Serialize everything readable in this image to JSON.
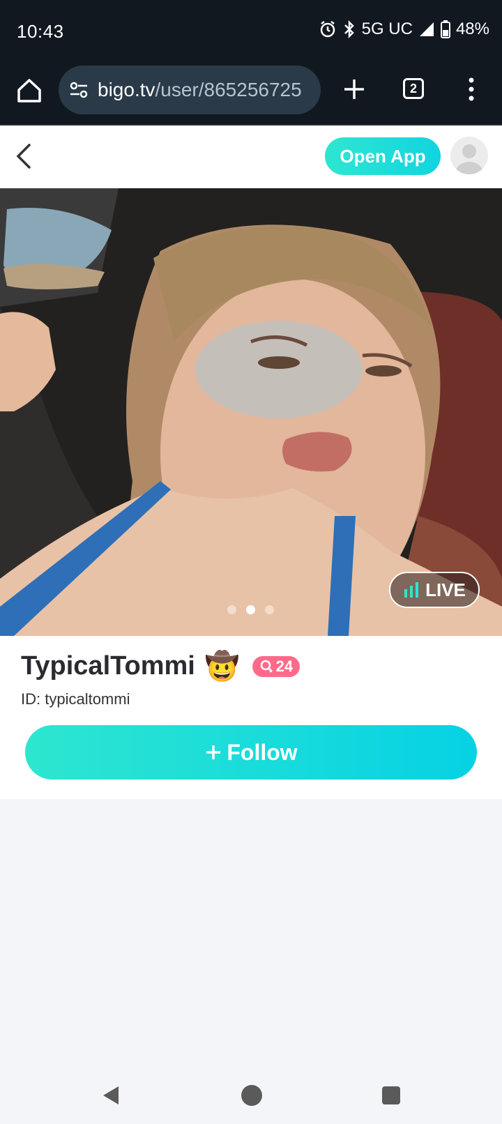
{
  "status_bar": {
    "time": "10:43",
    "network": "5G UC",
    "battery": "48%"
  },
  "browser": {
    "url_host": "bigo.tv",
    "url_path": "/user/865256725",
    "tab_count": "2"
  },
  "header": {
    "open_app_label": "Open App"
  },
  "media": {
    "live_label": "LIVE",
    "carousel_total": 3,
    "carousel_active": 2
  },
  "profile": {
    "username": "TypicalTommi",
    "emoji": "🤠",
    "level": "24",
    "id_text": "ID: typicaltommi",
    "follow_label": "Follow"
  },
  "colors": {
    "accent": "#12d4e0",
    "level_badge": "#ff6a8a"
  }
}
